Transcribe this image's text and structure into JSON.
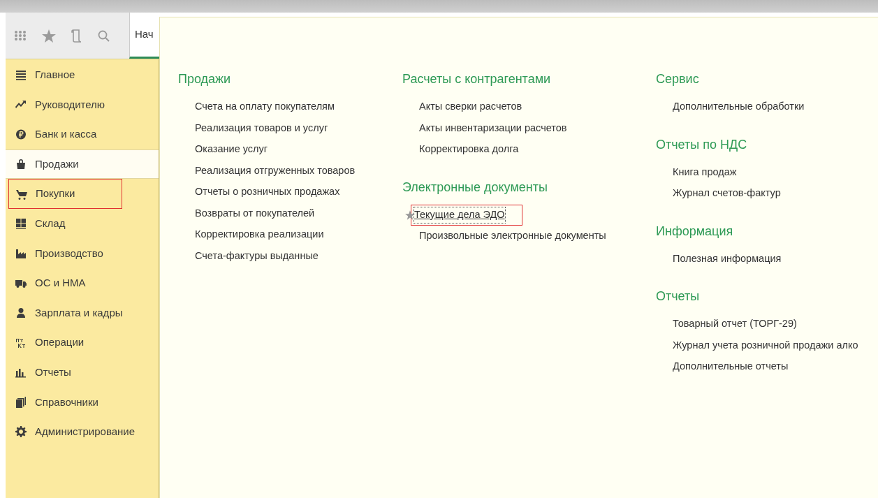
{
  "toolbar": {
    "tab": {
      "label": "Нач",
      "selected": true
    }
  },
  "sidebar": {
    "items": [
      {
        "label": "Главное",
        "kind": "menu",
        "selected": false,
        "highlighted": false
      },
      {
        "label": "Руководителю",
        "kind": "trend",
        "selected": false,
        "highlighted": false
      },
      {
        "label": "Банк и касса",
        "kind": "ruble",
        "selected": false,
        "highlighted": false
      },
      {
        "label": "Продажи",
        "kind": "bag",
        "selected": true,
        "highlighted": false
      },
      {
        "label": "Покупки",
        "kind": "cart",
        "selected": false,
        "highlighted": true
      },
      {
        "label": "Склад",
        "kind": "grid",
        "selected": false,
        "highlighted": false
      },
      {
        "label": "Производство",
        "kind": "factory",
        "selected": false,
        "highlighted": false
      },
      {
        "label": "ОС и НМА",
        "kind": "truck",
        "selected": false,
        "highlighted": false
      },
      {
        "label": "Зарплата и кадры",
        "kind": "person",
        "selected": false,
        "highlighted": false
      },
      {
        "label": "Операции",
        "kind": "dtkt",
        "selected": false,
        "highlighted": false
      },
      {
        "label": "Отчеты",
        "kind": "bars",
        "selected": false,
        "highlighted": false
      },
      {
        "label": "Справочники",
        "kind": "books",
        "selected": false,
        "highlighted": false
      },
      {
        "label": "Администрирование",
        "kind": "gear",
        "selected": false,
        "highlighted": false
      }
    ]
  },
  "columns": [
    {
      "sections": [
        {
          "title": "Продажи",
          "links": [
            {
              "label": "Счета на оплату покупателям",
              "starred": false,
              "highlighted": false
            },
            {
              "label": "Реализация товаров и услуг",
              "starred": false,
              "highlighted": false
            },
            {
              "label": "Оказание услуг",
              "starred": false,
              "highlighted": false
            },
            {
              "label": "Реализация отгруженных товаров",
              "starred": false,
              "highlighted": false
            },
            {
              "label": "Отчеты о розничных продажах",
              "starred": false,
              "highlighted": false
            },
            {
              "label": "Возвраты от покупателей",
              "starred": false,
              "highlighted": false
            },
            {
              "label": "Корректировка реализации",
              "starred": false,
              "highlighted": false
            },
            {
              "label": "Счета-фактуры выданные",
              "starred": false,
              "highlighted": false
            }
          ]
        }
      ]
    },
    {
      "sections": [
        {
          "title": "Расчеты с контрагентами",
          "links": [
            {
              "label": "Акты сверки расчетов",
              "starred": false,
              "highlighted": false
            },
            {
              "label": "Акты инвентаризации расчетов",
              "starred": false,
              "highlighted": false
            },
            {
              "label": "Корректировка долга",
              "starred": false,
              "highlighted": false
            }
          ]
        },
        {
          "title": "Электронные документы",
          "links": [
            {
              "label": "Текущие дела ЭДО",
              "starred": true,
              "highlighted": true
            },
            {
              "label": "Произвольные электронные документы",
              "starred": false,
              "highlighted": false
            }
          ]
        }
      ]
    },
    {
      "sections": [
        {
          "title": "Сервис",
          "links": [
            {
              "label": "Дополнительные обработки",
              "starred": false,
              "highlighted": false
            }
          ]
        },
        {
          "title": "Отчеты по НДС",
          "links": [
            {
              "label": "Книга продаж",
              "starred": false,
              "highlighted": false
            },
            {
              "label": "Журнал счетов-фактур",
              "starred": false,
              "highlighted": false
            }
          ]
        },
        {
          "title": "Информация",
          "links": [
            {
              "label": "Полезная информация",
              "starred": false,
              "highlighted": false
            }
          ]
        },
        {
          "title": "Отчеты",
          "links": [
            {
              "label": "Товарный отчет (ТОРГ-29)",
              "starred": false,
              "highlighted": false
            },
            {
              "label": "Журнал учета розничной продажи алко",
              "starred": false,
              "highlighted": false
            },
            {
              "label": "Дополнительные отчеты",
              "starred": false,
              "highlighted": false
            }
          ]
        }
      ]
    }
  ]
}
